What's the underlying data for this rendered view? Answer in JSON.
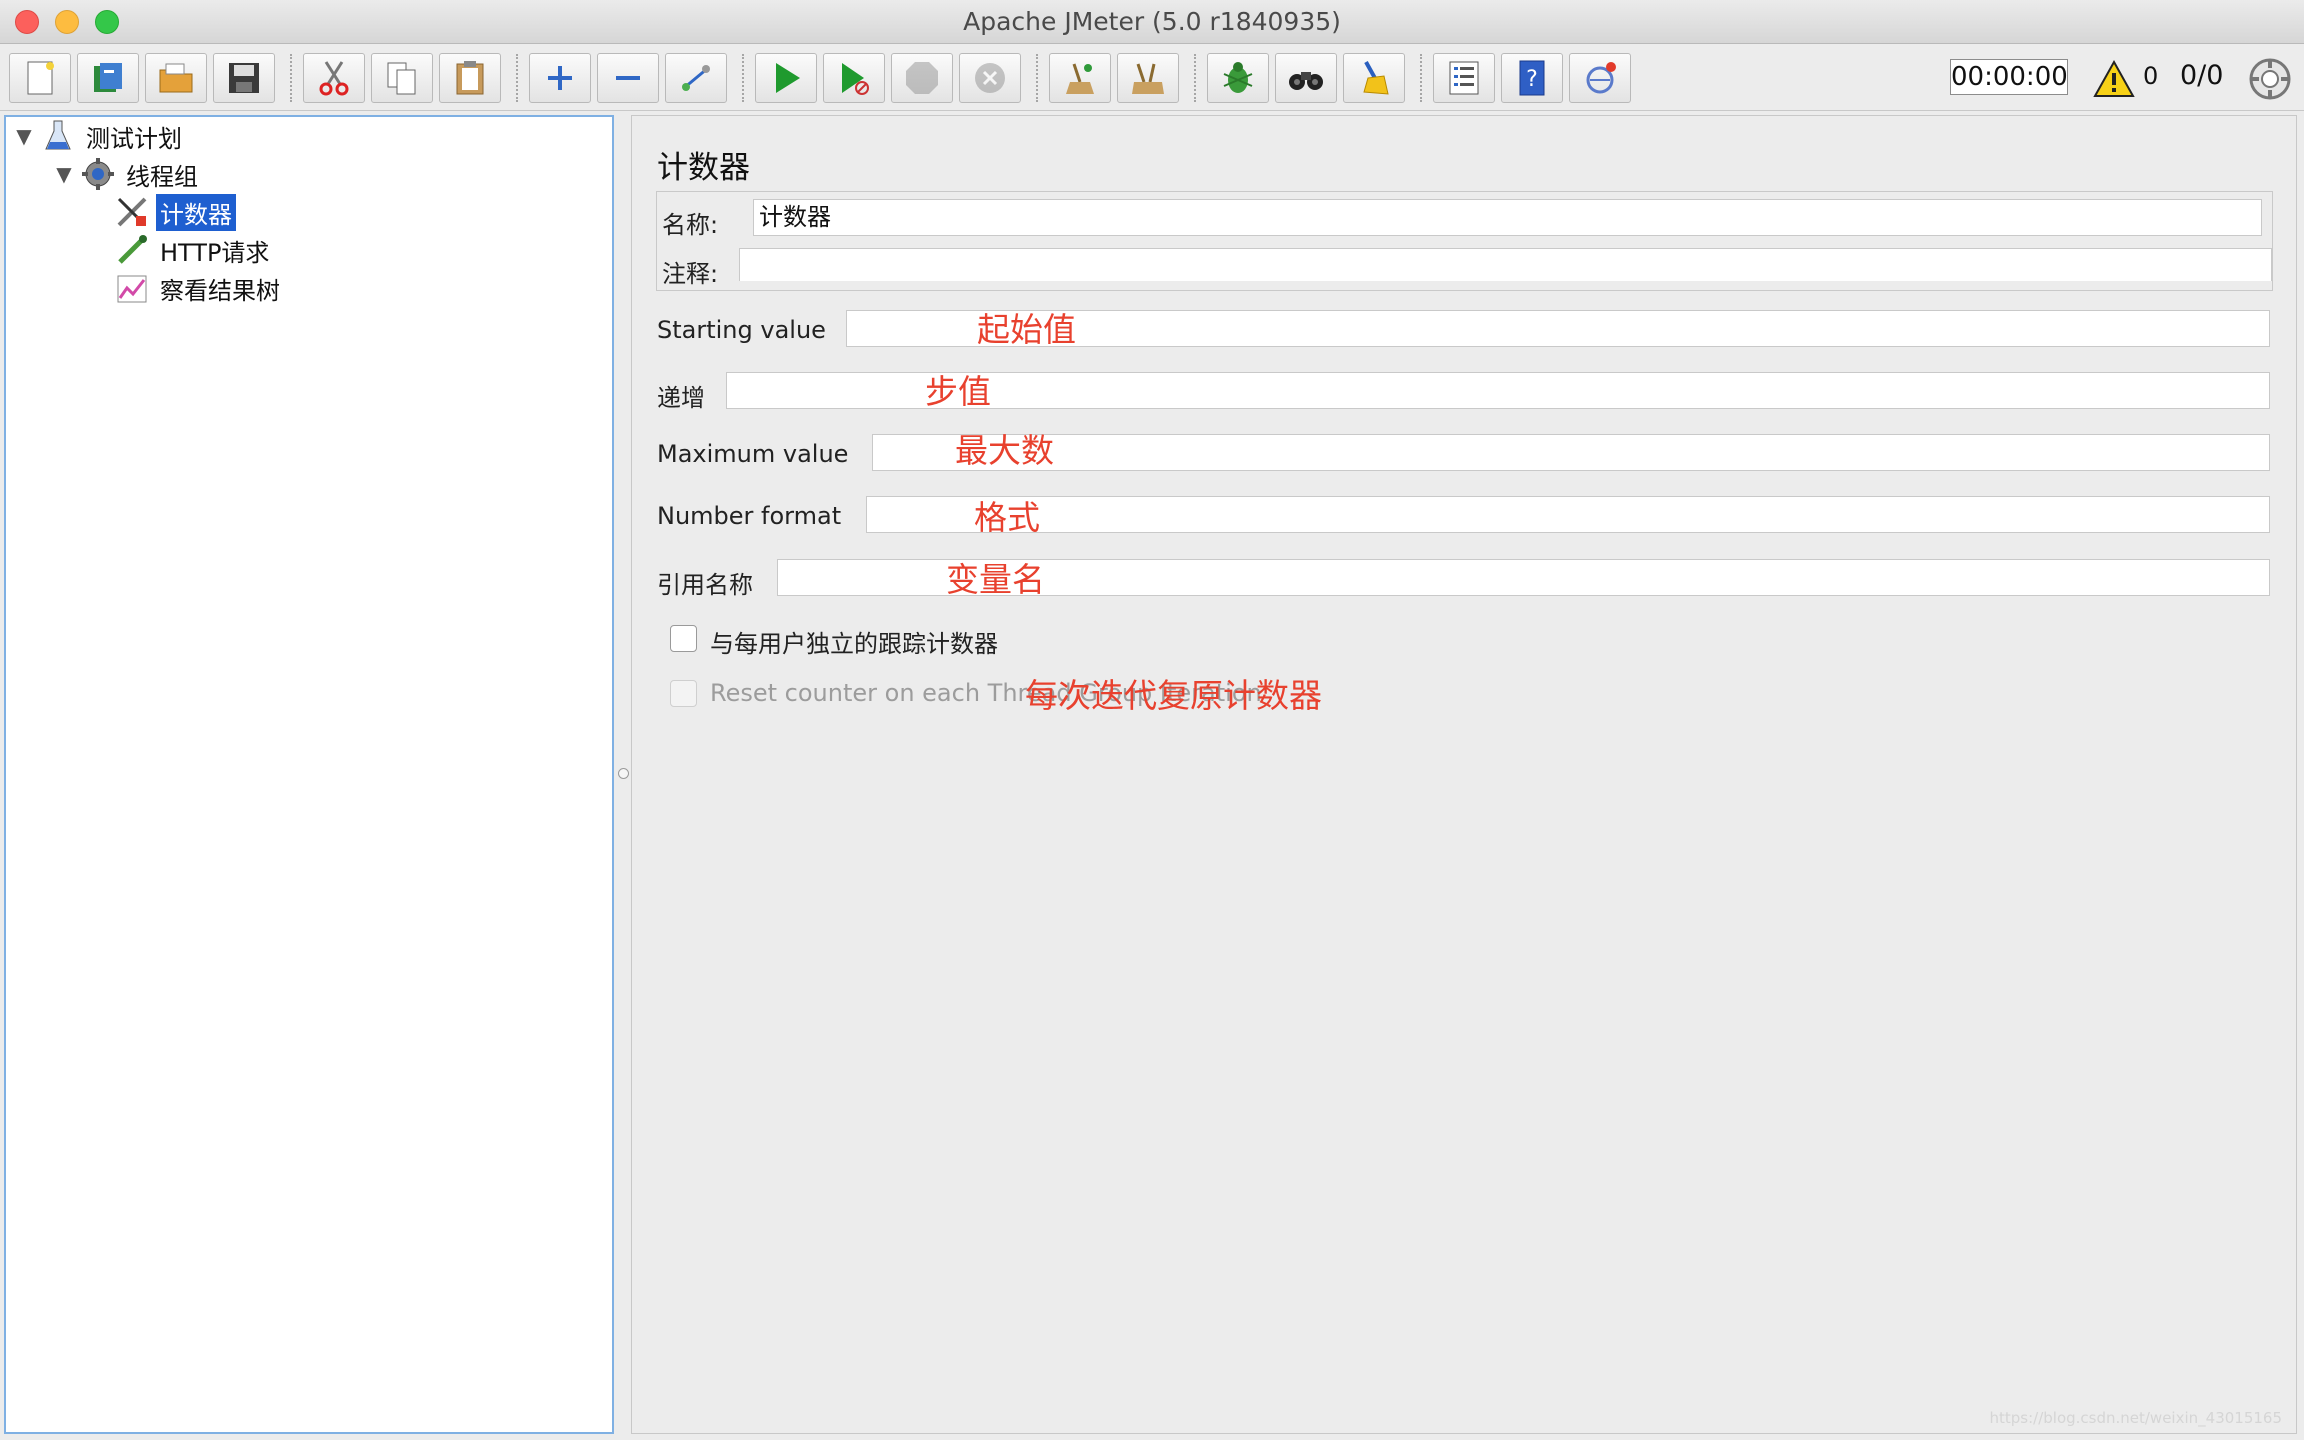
{
  "window": {
    "title": "Apache JMeter (5.0 r1840935)"
  },
  "toolbar": {
    "buttons": [
      {
        "name": "new"
      },
      {
        "name": "templates"
      },
      {
        "name": "open"
      },
      {
        "name": "save"
      },
      {
        "name": "cut"
      },
      {
        "name": "copy"
      },
      {
        "name": "paste"
      },
      {
        "name": "expand"
      },
      {
        "name": "collapse"
      },
      {
        "name": "toggle"
      },
      {
        "name": "start"
      },
      {
        "name": "start-no-pauses"
      },
      {
        "name": "stop"
      },
      {
        "name": "shutdown"
      },
      {
        "name": "remote-start"
      },
      {
        "name": "remote-stop"
      },
      {
        "name": "debug"
      },
      {
        "name": "search"
      },
      {
        "name": "clear"
      },
      {
        "name": "function-helper"
      },
      {
        "name": "help"
      },
      {
        "name": "remote"
      }
    ],
    "timer": "00:00:00",
    "warning_count": "0",
    "threads": "0/0"
  },
  "tree": {
    "items": [
      {
        "label": "测试计划",
        "icon": "test-plan-icon"
      },
      {
        "label": "线程组",
        "icon": "thread-group-icon"
      },
      {
        "label": "计数器",
        "icon": "counter-icon",
        "selected": true
      },
      {
        "label": "HTTP请求",
        "icon": "http-request-icon"
      },
      {
        "label": "察看结果树",
        "icon": "results-tree-icon"
      }
    ]
  },
  "panel": {
    "title": "计数器",
    "name_label": "名称:",
    "name_value": "计数器",
    "comment_label": "注释:",
    "comment_value": "",
    "fields": [
      {
        "label": "Starting value",
        "value": "",
        "note": "起始值"
      },
      {
        "label": "递增",
        "value": "",
        "note": "步值"
      },
      {
        "label": "Maximum value",
        "value": "",
        "note": "最大数"
      },
      {
        "label": "Number format",
        "value": "",
        "note": "格式"
      },
      {
        "label": "引用名称",
        "value": "",
        "note": "变量名"
      }
    ],
    "checkbox_per_user": {
      "label": "与每用户独立的跟踪计数器",
      "checked": false
    },
    "checkbox_reset": {
      "label": "Reset counter on each Thread Group Iteration",
      "checked": false,
      "note": "每次迭代复原计数器"
    }
  },
  "watermark": "https://blog.csdn.net/weixin_43015165"
}
